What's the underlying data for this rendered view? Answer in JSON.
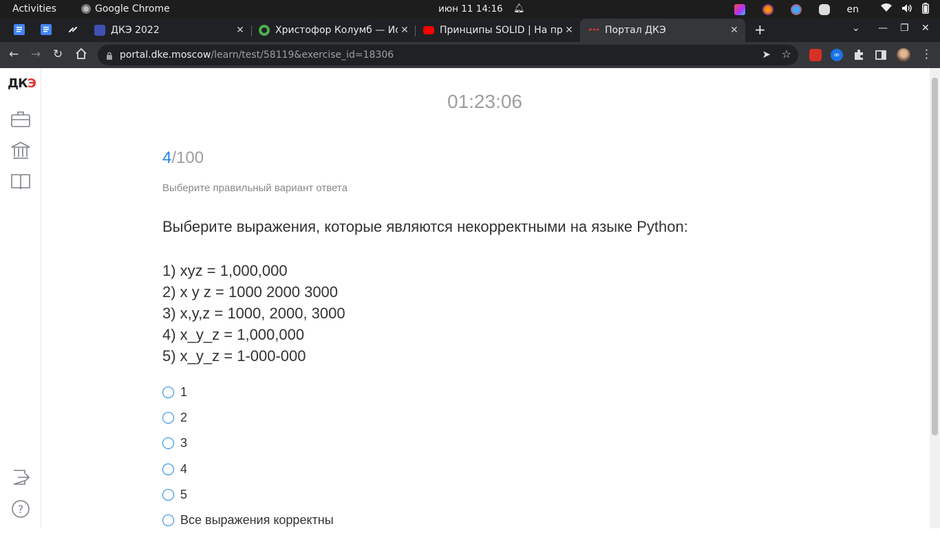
{
  "system_bar": {
    "activities": "Activities",
    "app_name": "Google Chrome",
    "date_time": "июн 11  14:16",
    "keyboard_layout": "en"
  },
  "tabs": [
    {
      "title": "ДКЭ 2022",
      "favicon": "dke-favicon"
    },
    {
      "title": "Христофор Колумб — Ис",
      "favicon": "green-circle-favicon"
    },
    {
      "title": "Принципы SOLID | На пр",
      "favicon": "youtube-favicon"
    },
    {
      "title": "Портал ДКЭ",
      "favicon": "dke-portal-favicon",
      "active": true
    }
  ],
  "address_bar": {
    "host": "portal.dke.moscow",
    "path": "/learn/test/58119&exercise_id=18306"
  },
  "sidebar": {
    "logo_main": "ДК",
    "logo_accent": "Э"
  },
  "test": {
    "timer": "01:23:06",
    "current": "4",
    "total": "/100",
    "hint": "Выберите правильный вариант ответа",
    "question": "Выберите выражения, которые являются некорректными на языке Python:",
    "expressions": [
      "1)  xyz = 1,000,000",
      "2)  x y z = 1000 2000 3000",
      "3)  x,y,z = 1000, 2000, 3000",
      "4)  x_y_z = 1,000,000",
      "5)  x_y_z = 1-000-000"
    ],
    "options": [
      "1",
      "2",
      "3",
      "4",
      "5",
      "Все выражения корректны"
    ]
  },
  "colors": {
    "accent": "#1e88e5",
    "logo_red": "#e53935"
  }
}
